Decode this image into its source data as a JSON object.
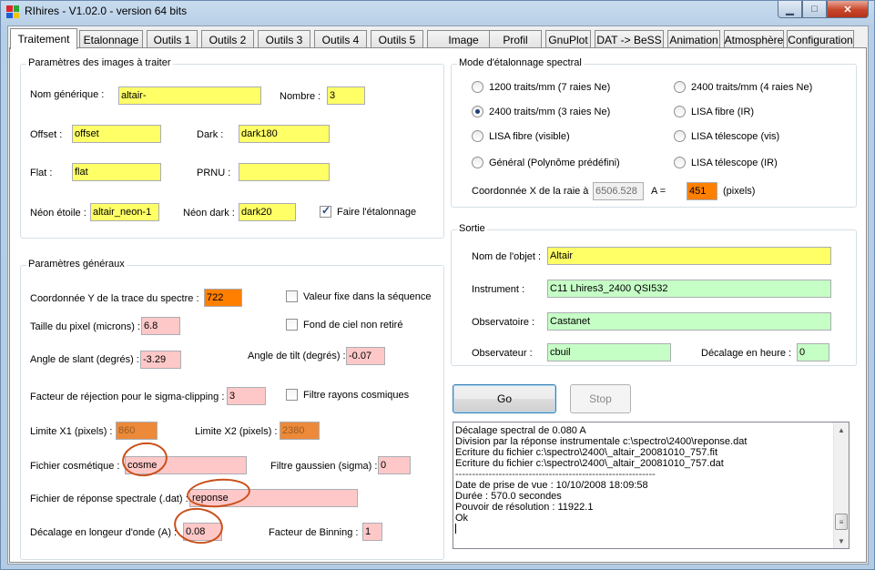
{
  "window": {
    "title": "RIhires - V1.02.0 - version 64 bits"
  },
  "tabs": [
    {
      "label": "Traitement",
      "active": true
    },
    {
      "label": "Etalonnage"
    },
    {
      "label": "Outils 1"
    },
    {
      "label": "Outils 2"
    },
    {
      "label": "Outils 3"
    },
    {
      "label": "Outils 4"
    },
    {
      "label": "Outils 5"
    },
    {
      "label": "Image"
    },
    {
      "label": "Profil"
    },
    {
      "label": "GnuPlot"
    },
    {
      "label": "DAT -> BeSS"
    },
    {
      "label": "Animation"
    },
    {
      "label": "Atmosphère"
    },
    {
      "label": "Configuration"
    }
  ],
  "images": {
    "title": "Paramètres des images à traiter",
    "nom_generique_label": "Nom générique :",
    "nom_generique": "altair-",
    "nombre_label": "Nombre :",
    "nombre": "3",
    "offset_label": "Offset :",
    "offset": "offset",
    "dark_label": "Dark :",
    "dark": "dark180",
    "flat_label": "Flat :",
    "flat": "flat",
    "prnu_label": "PRNU :",
    "prnu": "",
    "neon_etoile_label": "Néon étoile :",
    "neon_etoile": "altair_neon-1",
    "neon_dark_label": "Néon dark :",
    "neon_dark": "dark20",
    "faire_etalonnage_label": "Faire l'étalonnage"
  },
  "general": {
    "title": "Paramètres généraux",
    "coord_y_label": "Coordonnée Y de la trace du spectre :",
    "coord_y": "722",
    "valeur_fixe_label": "Valeur fixe dans la séquence",
    "taille_pixel_label": "Taille du pixel (microns) :",
    "taille_pixel": "6.8",
    "fond_ciel_label": "Fond de ciel non retiré",
    "slant_label": "Angle de slant (degrés) :",
    "slant": "-3.29",
    "tilt_label": "Angle de tilt (degrés) :",
    "tilt": "-0.07",
    "sigma_label": "Facteur de réjection pour le sigma-clipping :",
    "sigma": "3",
    "filtre_cosmiques_label": "Filtre rayons cosmiques",
    "x1_label": "Limite X1 (pixels) :",
    "x1": "860",
    "x2_label": "Limite X2 (pixels) :",
    "x2": "2380",
    "cosmetique_label": "Fichier cosmétique :",
    "cosmetique": "cosme",
    "gaussien_label": "Filtre gaussien (sigma) :",
    "gaussien": "0",
    "reponse_label": "Fichier de réponse spectrale (.dat) :",
    "reponse": "reponse",
    "decalage_label": "Décalage en longeur d'onde (A) :",
    "decalage": "0.08",
    "binning_label": "Facteur de Binning :",
    "binning": "1"
  },
  "mode": {
    "title": "Mode d'étalonnage spectral",
    "options": [
      {
        "label": "1200 traits/mm (7 raies Ne)",
        "checked": false
      },
      {
        "label": "2400 traits/mm (4 raies Ne)",
        "checked": false
      },
      {
        "label": "2400 traits/mm (3 raies Ne)",
        "checked": true
      },
      {
        "label": "LISA fibre (IR)",
        "checked": false
      },
      {
        "label": "LISA fibre (visible)",
        "checked": false
      },
      {
        "label": "LISA télescope (vis)",
        "checked": false
      },
      {
        "label": "Général (Polynôme prédéfini)",
        "checked": false
      },
      {
        "label": "LISA télescope (IR)",
        "checked": false
      }
    ],
    "coord_x_label": "Coordonnée X de la raie à",
    "coord_x_value": "6506.528",
    "a_label": "A =",
    "a_value": "451",
    "pixels_label": "(pixels)"
  },
  "sortie": {
    "title": "Sortie",
    "objet_label": "Nom de l'objet :",
    "objet": "Altair",
    "instrument_label": "Instrument :",
    "instrument": "C11 Lhires3_2400 QSI532",
    "observatoire_label": "Observatoire :",
    "observatoire": "Castanet",
    "observateur_label": "Observateur :",
    "observateur": "cbuil",
    "decalage_heure_label": "Décalage en heure :",
    "decalage_heure": "0"
  },
  "buttons": {
    "go": "Go",
    "stop": "Stop"
  },
  "log": [
    "Décalage spectral de 0.080 A",
    "Division par la réponse instrumentale c:\\spectro\\2400\\reponse.dat",
    "Ecriture du fichier c:\\spectro\\2400\\_altair_20081010_757.fit",
    "Ecriture du fichier c:\\spectro\\2400\\_altair_20081010_757.dat",
    "------------------------------------------------------------",
    "Date de prise de vue : 10/10/2008 18:09:58",
    "Durée : 570.0 secondes",
    "Pouvoir de résolution : 11922.1",
    "Ok"
  ],
  "colors": {
    "yellow_field": "#ffff66",
    "pink_field": "#ffc8c8",
    "green_field": "#c6ffc6",
    "orange_field": "#ff7f00",
    "annotation": "#c9501a"
  },
  "icons": [
    "app-icon",
    "minimize-icon",
    "maximize-icon",
    "close-icon",
    "scroll-up-icon",
    "scroll-down-icon",
    "scroll-grip-icon"
  ]
}
